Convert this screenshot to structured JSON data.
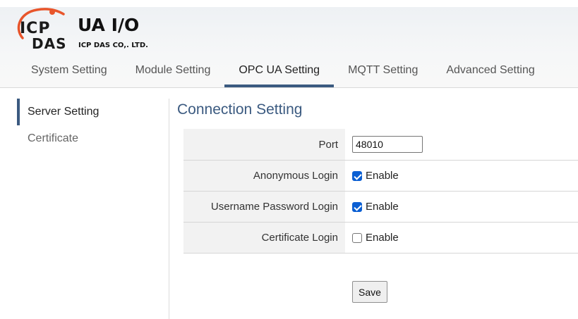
{
  "brand": {
    "logo_line1": "ICP",
    "logo_line2": "DAS",
    "app_title": "UA I/O",
    "company": "ICP DAS CO,. LTD.",
    "accent_color": "#3b5a80",
    "logo_arc_color": "#e8552b"
  },
  "nav": {
    "tabs": [
      {
        "label": "System Setting"
      },
      {
        "label": "Module Setting"
      },
      {
        "label": "OPC UA Setting",
        "active": true
      },
      {
        "label": "MQTT Setting"
      },
      {
        "label": "Advanced Setting"
      }
    ]
  },
  "sidebar": {
    "items": [
      {
        "label": "Server Setting",
        "active": true
      },
      {
        "label": "Certificate"
      }
    ]
  },
  "main": {
    "title": "Connection Setting",
    "port": {
      "label": "Port",
      "value": "48010"
    },
    "anonymous_login": {
      "label": "Anonymous Login",
      "checked": true,
      "option": "Enable"
    },
    "username_login": {
      "label": "Username Password Login",
      "checked": true,
      "option": "Enable"
    },
    "certificate_login": {
      "label": "Certificate Login",
      "checked": false,
      "option": "Enable"
    },
    "save_label": "Save"
  }
}
